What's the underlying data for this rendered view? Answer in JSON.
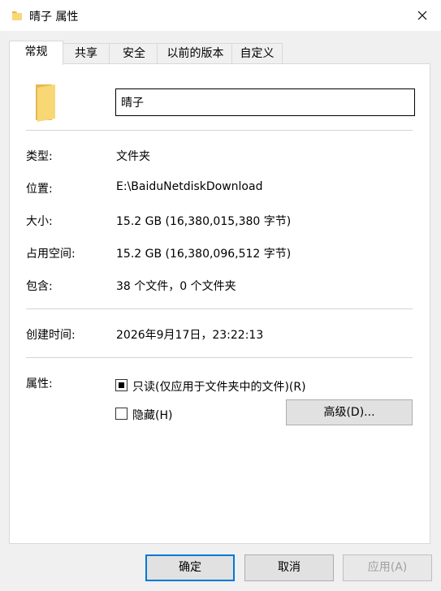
{
  "window": {
    "title": "晴子 属性",
    "icon": "folder-icon",
    "close_icon": "close-icon"
  },
  "tabs": [
    {
      "label": "常规",
      "active": true
    },
    {
      "label": "共享",
      "active": false
    },
    {
      "label": "安全",
      "active": false
    },
    {
      "label": "以前的版本",
      "active": false
    },
    {
      "label": "自定义",
      "active": false
    }
  ],
  "general": {
    "folder_name": "晴子",
    "type_label": "类型:",
    "type_value": "文件夹",
    "location_label": "位置:",
    "location_value": "E:\\BaiduNetdiskDownload",
    "size_label": "大小:",
    "size_value": "15.2 GB (16,380,015,380 字节)",
    "disk_size_label": "占用空间:",
    "disk_size_value": "15.2 GB (16,380,096,512 字节)",
    "contains_label": "包含:",
    "contains_value": "38 个文件，0 个文件夹",
    "created_label": "创建时间:",
    "created_value": "2026年9月17日，23:22:13",
    "attributes_label": "属性:",
    "readonly_label": "只读(仅应用于文件夹中的文件)(R)",
    "readonly_state": "indeterminate",
    "hidden_label": "隐藏(H)",
    "hidden_state": "unchecked",
    "advanced_button": "高级(D)..."
  },
  "footer": {
    "ok": "确定",
    "cancel": "取消",
    "apply": "应用(A)"
  },
  "colors": {
    "folder": "#f8d775",
    "folder_dark": "#e7b84f",
    "accent": "#0078d7"
  }
}
